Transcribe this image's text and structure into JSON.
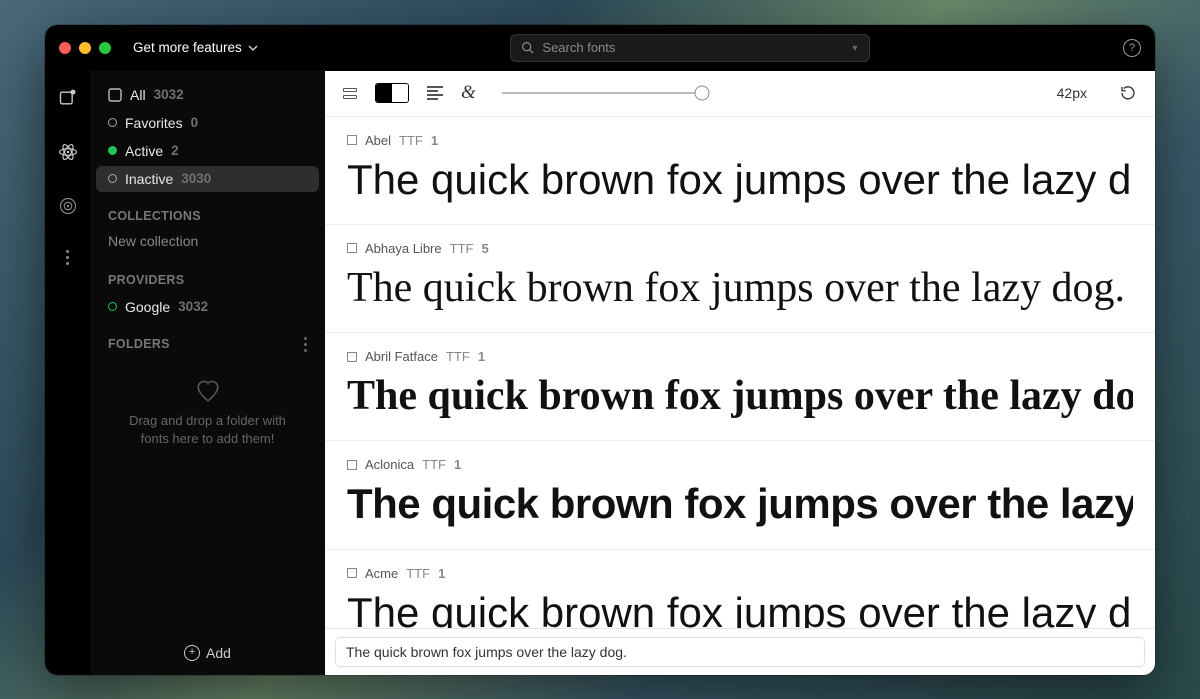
{
  "titlebar": {
    "features_label": "Get more features",
    "search_placeholder": "Search fonts"
  },
  "sidebar": {
    "all_label": "All",
    "all_count": "3032",
    "favorites_label": "Favorites",
    "favorites_count": "0",
    "active_label": "Active",
    "active_count": "2",
    "inactive_label": "Inactive",
    "inactive_count": "3030",
    "collections_header": "COLLECTIONS",
    "new_collection_label": "New collection",
    "providers_header": "PROVIDERS",
    "provider_google_label": "Google",
    "provider_google_count": "3032",
    "folders_header": "FOLDERS",
    "folders_empty_text": "Drag and drop a folder with fonts here to add them!",
    "add_label": "Add"
  },
  "toolbar": {
    "size_label": "42px",
    "ampersand": "&"
  },
  "preview_text": "The quick brown fox jumps over the lazy dog.",
  "fonts": [
    {
      "name": "Abel",
      "format": "TTF",
      "count": "1",
      "style": "sans"
    },
    {
      "name": "Abhaya Libre",
      "format": "TTF",
      "count": "5",
      "style": "serif"
    },
    {
      "name": "Abril Fatface",
      "format": "TTF",
      "count": "1",
      "style": "fat"
    },
    {
      "name": "Aclonica",
      "format": "TTF",
      "count": "1",
      "style": "deco"
    },
    {
      "name": "Acme",
      "format": "TTF",
      "count": "1",
      "style": "sans"
    }
  ],
  "input_value": "The quick brown fox jumps over the lazy dog."
}
